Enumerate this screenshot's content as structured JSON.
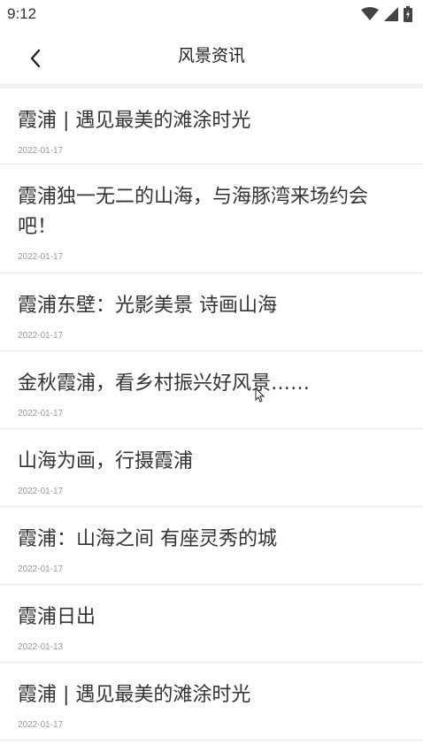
{
  "status_bar": {
    "time": "9:12",
    "icons": [
      "wifi-icon",
      "cellular-signal-icon",
      "battery-icon"
    ]
  },
  "header": {
    "back_icon": "chevron-left-icon",
    "title": "风景资讯"
  },
  "news": [
    {
      "title": "霞浦 | 遇见最美的滩涂时光",
      "date": "2022-01-17"
    },
    {
      "title": "霞浦独一无二的山海，与海豚湾来场约会吧！",
      "date": "2022-01-17"
    },
    {
      "title": "霞浦东壁：光影美景 诗画山海",
      "date": "2022-01-17"
    },
    {
      "title": "金秋霞浦，看乡村振兴好风景……",
      "date": "2022-01-17"
    },
    {
      "title": "山海为画，行摄霞浦",
      "date": "2022-01-17"
    },
    {
      "title": "霞浦：山海之间 有座灵秀的城",
      "date": "2022-01-17"
    },
    {
      "title": "霞浦日出",
      "date": "2022-01-13"
    },
    {
      "title": "霞浦 | 遇见最美的滩涂时光",
      "date": "2022-01-17"
    }
  ]
}
